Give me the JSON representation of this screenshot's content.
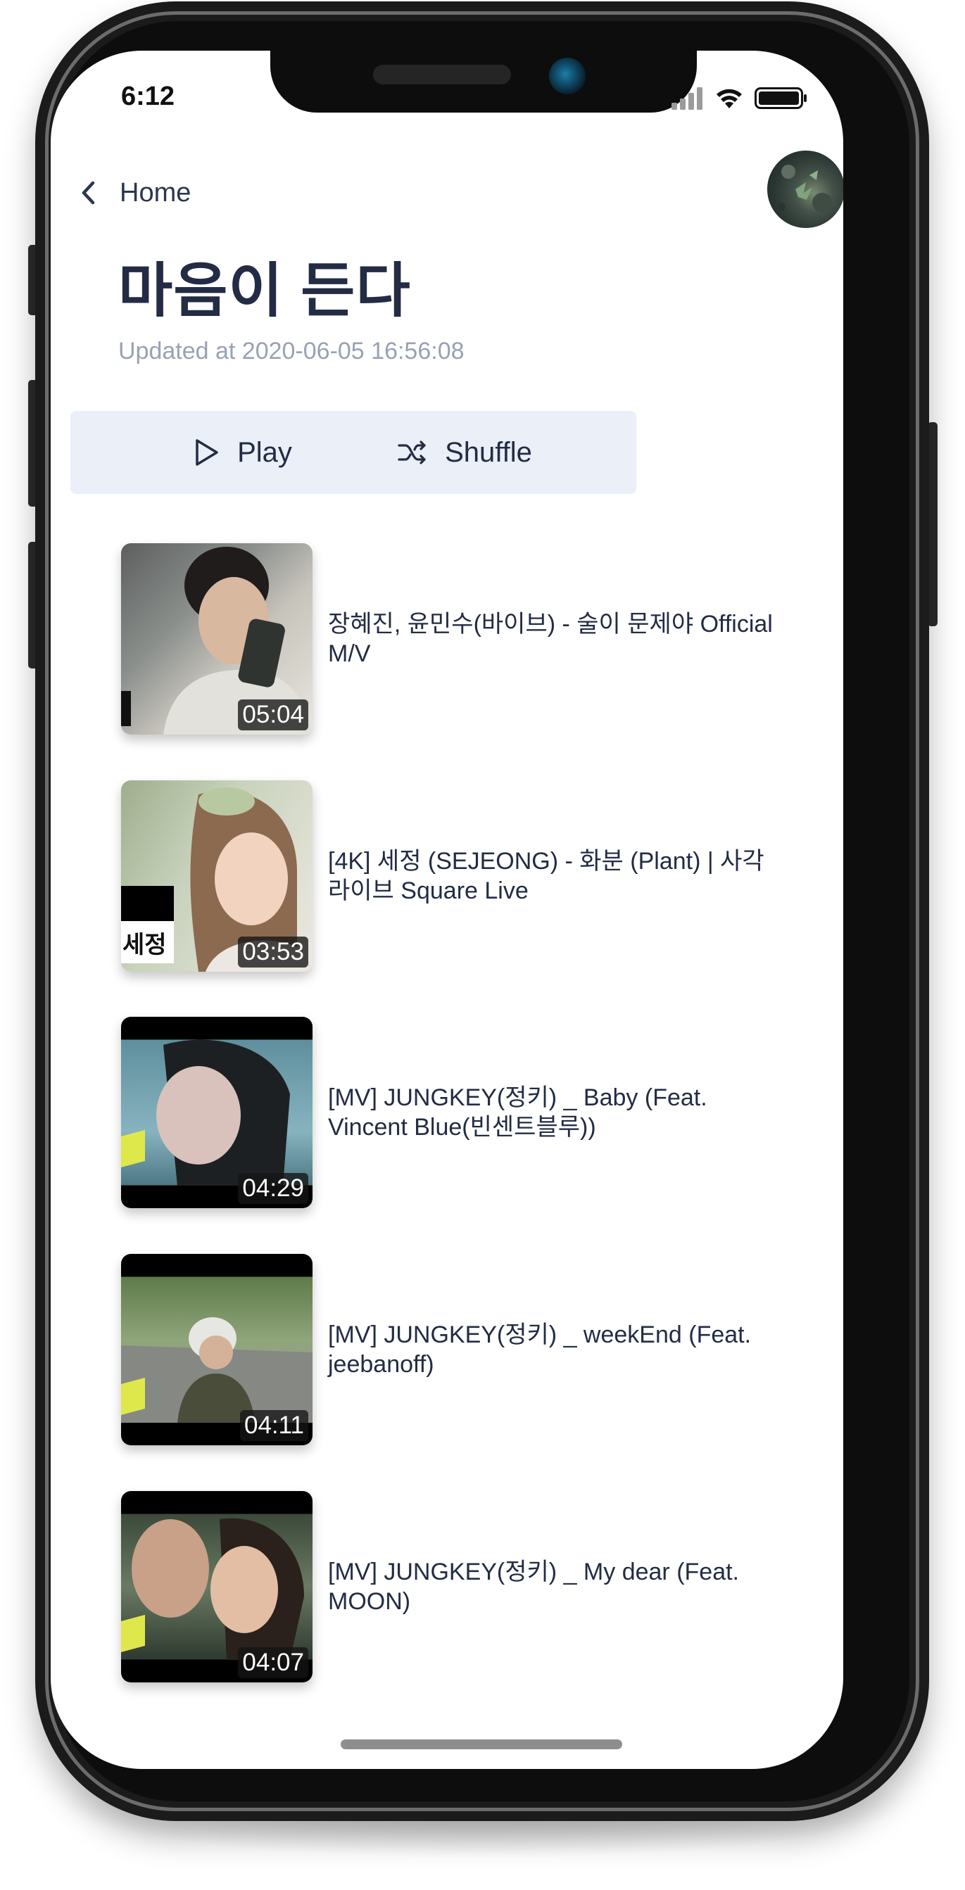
{
  "status_bar": {
    "time": "6:12"
  },
  "header": {
    "back_label": "Home"
  },
  "playlist": {
    "title": "마음이 든다",
    "updated": "Updated at 2020-06-05 16:56:08"
  },
  "actions": {
    "play_label": "Play",
    "shuffle_label": "Shuffle"
  },
  "colors": {
    "accent": "#e9435a",
    "title": "#232c44",
    "muted": "#98a2b4",
    "button_bg": "#ebeff8"
  },
  "videos": [
    {
      "title": "장혜진, 윤민수(바이브) - 술이 문제야 Official M/V",
      "duration": "05:04",
      "liked": true
    },
    {
      "title": "[4K] 세정 (SEJEONG) - 화분 (Plant) | 사각라이브 Square Live",
      "duration": "03:53",
      "liked": true,
      "thumb_caption": "세정"
    },
    {
      "title": "[MV] JUNGKEY(정키) _ Baby (Feat. Vincent Blue(빈센트블루))",
      "duration": "04:29",
      "liked": false
    },
    {
      "title": "[MV] JUNGKEY(정키) _ weekEnd (Feat. jeebanoff)",
      "duration": "04:11",
      "liked": true
    },
    {
      "title": "[MV] JUNGKEY(정키) _ My dear (Feat. MOON)",
      "duration": "04:07",
      "liked": false
    }
  ]
}
